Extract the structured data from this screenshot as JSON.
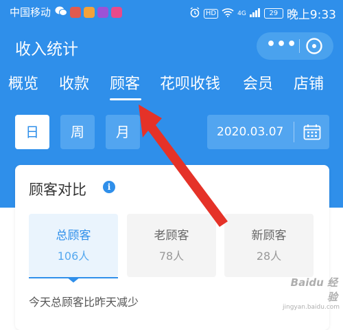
{
  "status_bar": {
    "carrier": "中国移动",
    "hd": "HD",
    "signal": "4G",
    "battery": "29",
    "time": "晚上9:33",
    "app_icon_colors": [
      "#e15a4f",
      "#f3a23a",
      "#9b52d6",
      "#e84a8a"
    ]
  },
  "header": {
    "title": "收入统计",
    "more_label": "•••"
  },
  "tabs": [
    {
      "label": "概览"
    },
    {
      "label": "收款"
    },
    {
      "label": "顾客"
    },
    {
      "label": "花呗收钱"
    },
    {
      "label": "会员"
    },
    {
      "label": "店铺"
    }
  ],
  "active_tab": "顾客",
  "period_buttons": [
    {
      "label": "日"
    },
    {
      "label": "周"
    },
    {
      "label": "月"
    }
  ],
  "active_period": "日",
  "date": "2020.03.07",
  "card": {
    "title": "顾客对比",
    "info_glyph": "i",
    "stats": [
      {
        "label": "总顾客",
        "value": "106人"
      },
      {
        "label": "老顾客",
        "value": "78人"
      },
      {
        "label": "新顾客",
        "value": "28人"
      }
    ],
    "comparison_text": "今天总顾客比昨天减少"
  },
  "watermark": {
    "logo": "Baidu 经验",
    "url": "jingyan.baidu.com"
  },
  "colors": {
    "primary": "#2f8fea",
    "annotation_arrow": "#e53228"
  }
}
